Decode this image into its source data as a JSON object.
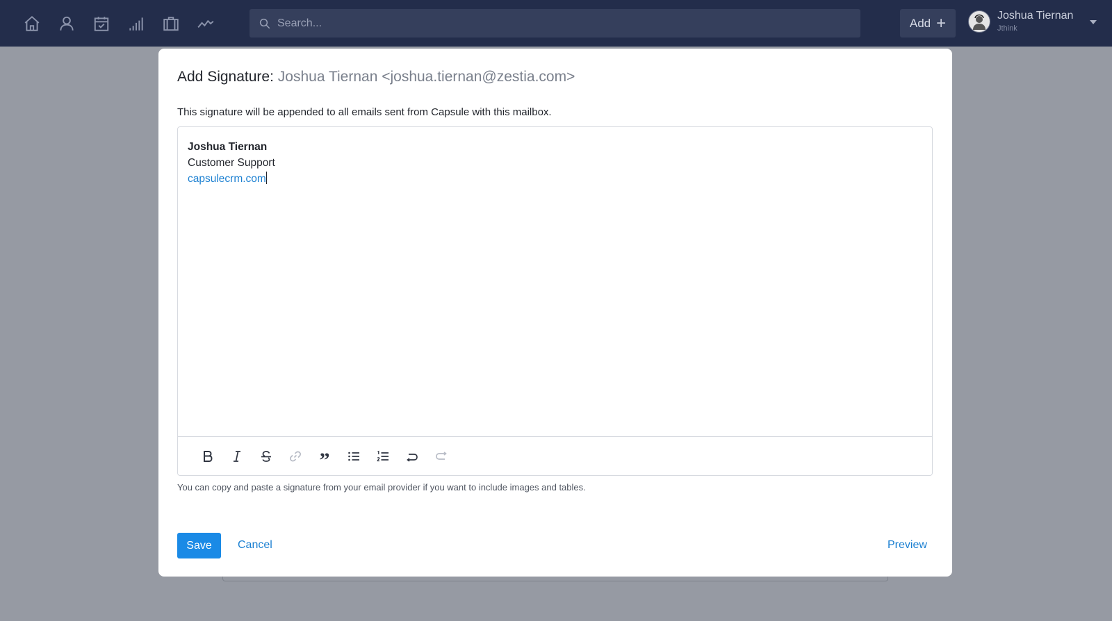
{
  "nav": {
    "icons": [
      "home-icon",
      "person-icon",
      "calendar-check-icon",
      "bar-chart-icon",
      "briefcase-icon",
      "activity-icon"
    ],
    "search_placeholder": "Search...",
    "add_label": "Add",
    "user": {
      "name": "Joshua Tiernan",
      "org": "Jthink"
    }
  },
  "modal": {
    "title_prefix": "Add Signature:",
    "title_sub": "Joshua Tiernan <joshua.tiernan@zestia.com>",
    "description": "This signature will be appended to all emails sent from Capsule with this mailbox.",
    "signature": {
      "name": "Joshua Tiernan",
      "role": "Customer Support",
      "link": "capsulecrm.com"
    },
    "toolbar": [
      "bold-icon",
      "italic-icon",
      "strikethrough-icon",
      "link-icon",
      "quote-icon",
      "bullet-list-icon",
      "numbered-list-icon",
      "undo-icon",
      "redo-icon"
    ],
    "hint": "You can copy and paste a signature from your email provider if you want to include images and tables.",
    "save_label": "Save",
    "cancel_label": "Cancel",
    "preview_label": "Preview"
  }
}
